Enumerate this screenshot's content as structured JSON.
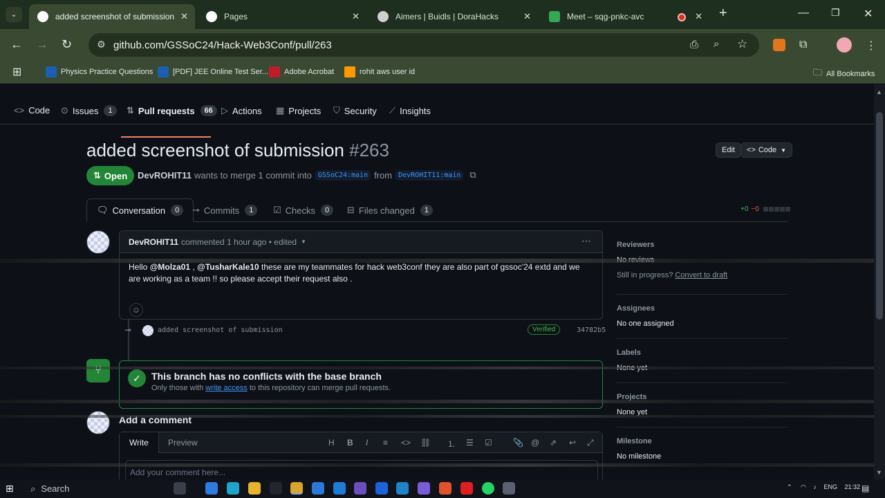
{
  "browser": {
    "tabs": [
      {
        "title": "added screenshot of submission by D",
        "active": true
      },
      {
        "title": "Pages",
        "active": false
      },
      {
        "title": "Aimers | Buidls | DoraHacks",
        "active": false
      },
      {
        "title": "Meet – sqg-pnkc-avc",
        "active": false
      }
    ],
    "url": "github.com/GSSoC24/Hack-Web3Conf/pull/263",
    "bookmarks": [
      {
        "label": "Physics Practice Questions"
      },
      {
        "label": "[PDF] JEE Online Test Ser..."
      },
      {
        "label": "Adobe Acrobat"
      },
      {
        "label": "rohit aws user id"
      }
    ],
    "all_bookmarks": "All Bookmarks"
  },
  "repo_nav": {
    "code": "Code",
    "issues": "Issues",
    "issues_count": "1",
    "pull_requests": "Pull requests",
    "pull_requests_count": "66",
    "actions": "Actions",
    "projects": "Projects",
    "security": "Security",
    "insights": "Insights"
  },
  "pr": {
    "title": "added screenshot of submission",
    "number": "#263",
    "edit_label": "Edit",
    "code_label": "Code",
    "status": "Open",
    "author": "DevROHIT11",
    "merge_text": "wants to merge 1 commit into",
    "base_branch": "GSSoC24:main",
    "from_text": "from",
    "head_branch": "DevROHIT11:main"
  },
  "pr_tabs": {
    "conversation": "Conversation",
    "conversation_count": "0",
    "commits": "Commits",
    "commits_count": "1",
    "checks": "Checks",
    "checks_count": "0",
    "files_changed": "Files changed",
    "files_changed_count": "1",
    "additions": "+0",
    "deletions": "−0"
  },
  "comment": {
    "author": "DevROHIT11",
    "meta": "commented 1 hour ago • edited",
    "body_prefix": "Hello",
    "mention1": "@Molza01",
    "sep": ",",
    "mention2": "@TusharKale10",
    "body_rest": "these are my teammates for hack web3conf they are also part of gssoc'24 extd and we are working as a team !! so please accept their request also ."
  },
  "commit": {
    "message": "added screenshot of submission",
    "verified": "Verified",
    "sha": "34782b5"
  },
  "merge_box": {
    "title": "This branch has no conflicts with the base branch",
    "sub_prefix": "Only those with",
    "sub_link": "write access",
    "sub_suffix": "to this repository can merge pull requests."
  },
  "add_comment": {
    "heading": "Add a comment",
    "write_tab": "Write",
    "preview_tab": "Preview",
    "placeholder": "Add your comment here..."
  },
  "sidebar": {
    "reviewers_heading": "Reviewers",
    "reviewers_value": "No reviews",
    "still_in_progress": "Still in progress?",
    "convert_to_draft": "Convert to draft",
    "assignees_heading": "Assignees",
    "assignees_value": "No one assigned",
    "labels_heading": "Labels",
    "labels_value": "None yet",
    "projects_heading": "Projects",
    "projects_value": "None yet",
    "milestone_heading": "Milestone",
    "milestone_value": "No milestone"
  },
  "taskbar": {
    "search": "Search",
    "lang": "ENG",
    "time": "21:32"
  },
  "colors": {
    "accent_green": "#238636",
    "link_blue": "#4493f8",
    "tab_underline": "#f78166",
    "browser_theme": "#3a4a32"
  }
}
